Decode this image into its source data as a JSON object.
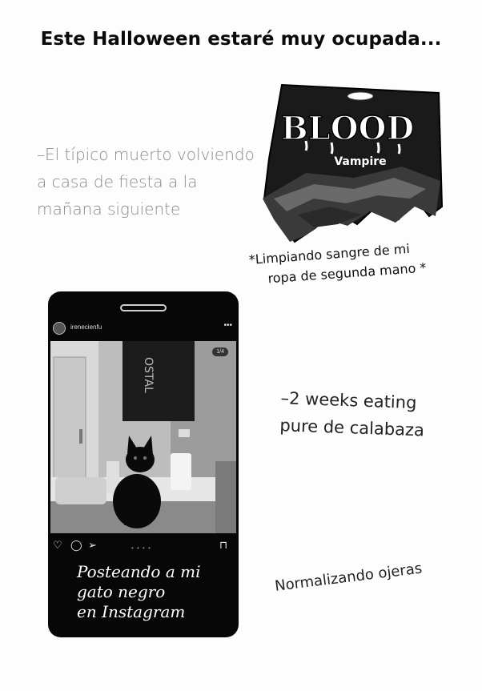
{
  "title": "Este Halloween estaré muy ocupada...",
  "intro_note": {
    "lines": [
      "–El típico muerto volviendo",
      "a casa de fiesta a la",
      "mañana siguiente"
    ]
  },
  "blood_pack": {
    "brand": "BLOOD",
    "sub": "Vampire"
  },
  "blood_caption": {
    "lines": [
      "*Limpiando sangre de mi",
      "ropa de segunda mano *"
    ]
  },
  "weeks_note": {
    "lines": [
      "–2 weeks eating",
      "pure de calabaza"
    ]
  },
  "ojeras_note": "Normalizando ojeras",
  "phone": {
    "username": "irenecienfu",
    "more": "•••",
    "counter": "1/4",
    "sign_text": "OSTAL",
    "carousel_dots": "• • • •",
    "caption_lines": [
      "Posteando a mi",
      "gato negro",
      "en Instagram"
    ],
    "icons": [
      "heart-icon",
      "comment-icon",
      "send-icon",
      "bookmark-icon"
    ]
  },
  "colors": {
    "page_bg": "#fdfdfd",
    "phone_bg": "#070707",
    "gray_text": "#8a8a8a"
  }
}
